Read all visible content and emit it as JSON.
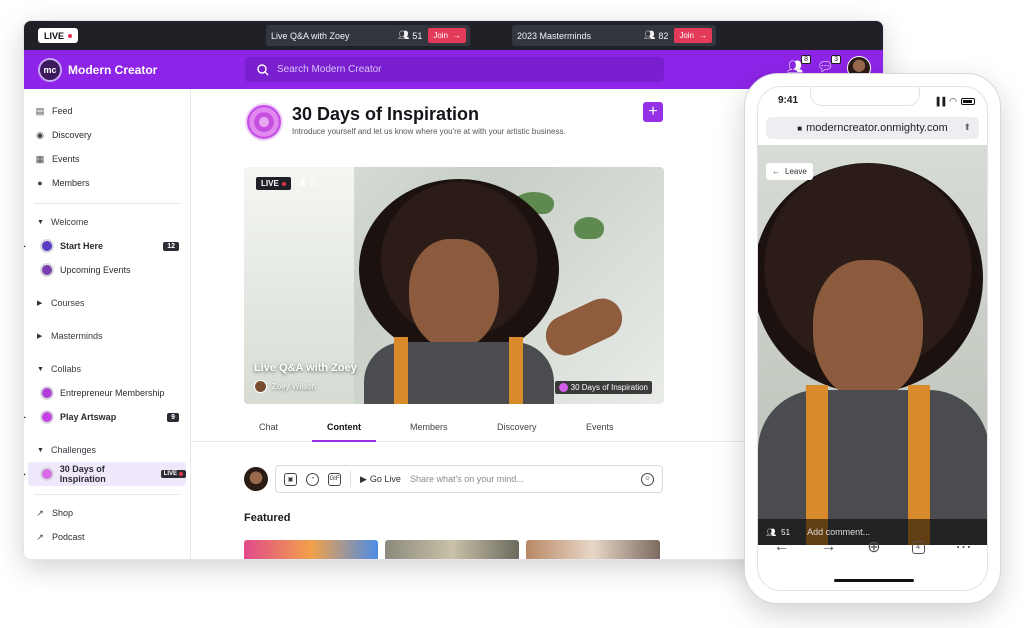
{
  "livebar": {
    "live_label": "LIVE",
    "sessions": [
      {
        "title": "Live Q&A with Zoey",
        "count": "51",
        "join": "Join"
      },
      {
        "title": "2023 Masterminds",
        "count": "82",
        "join": "Join"
      }
    ]
  },
  "header": {
    "logo_text": "mc",
    "brand": "Modern Creator",
    "search_placeholder": "Search Modern Creator",
    "badges": [
      "8",
      "3"
    ]
  },
  "sidebar": {
    "nav": [
      {
        "label": "Feed",
        "icon": "feed-icon"
      },
      {
        "label": "Discovery",
        "icon": "compass-icon"
      },
      {
        "label": "Events",
        "icon": "calendar-icon"
      },
      {
        "label": "Members",
        "icon": "members-icon"
      }
    ],
    "groups": {
      "welcome": "Welcome",
      "courses": "Courses",
      "masterminds": "Masterminds",
      "collabs": "Collabs",
      "challenges": "Challenges"
    },
    "spaces": {
      "start_here": {
        "label": "Start Here",
        "count": "12",
        "color": "#5b3cc4"
      },
      "upcoming_events": {
        "label": "Upcoming Events",
        "color": "#7a3fae"
      },
      "entrepreneur": {
        "label": "Entrepreneur Membership",
        "color": "#b13fd8"
      },
      "play_artswap": {
        "label": "Play Artswap",
        "count": "9",
        "color": "#c640e3"
      },
      "thirty_days": {
        "label": "30 Days of Inspiration",
        "live": "LIVE",
        "color": "#d66be8"
      }
    },
    "footer": [
      {
        "label": "Shop",
        "icon": "external-link-icon"
      },
      {
        "label": "Podcast",
        "icon": "external-link-icon"
      }
    ]
  },
  "space": {
    "title": "30 Days of Inspiration",
    "subtitle": "Introduce yourself and let us know where you're at with your artistic business."
  },
  "video": {
    "live": "LIVE",
    "viewers": "51",
    "title": "Live Q&A with Zoey",
    "host": "Zoey Wilson",
    "space_tag": "30 Days of Inspiration"
  },
  "tabs": [
    "Chat",
    "Content",
    "Members",
    "Discovery",
    "Events"
  ],
  "composer": {
    "gif": "GIF",
    "go_live": "Go Live",
    "placeholder": "Share what's on your mind..."
  },
  "featured": "Featured",
  "phone": {
    "time": "9:41",
    "url": "moderncreator.onmighty.com",
    "leave": "Leave",
    "viewers": "51",
    "comment_placeholder": "Add comment...",
    "tab_count": "4"
  },
  "colors": {
    "accent": "#9431e6",
    "header": "#8e24e8",
    "live": "#e0324f",
    "join": "#e33a5a"
  }
}
